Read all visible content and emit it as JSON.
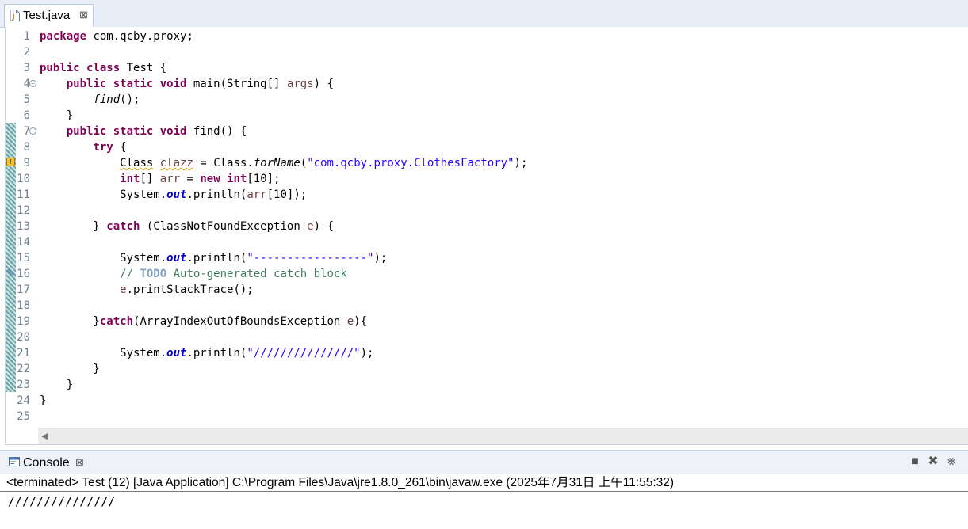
{
  "editor": {
    "tab_label": "Test.java",
    "tab_close_glyph": "⊠",
    "lines": [
      {
        "n": "1",
        "tokens": [
          {
            "c": "kw",
            "t": "package"
          },
          {
            "c": "",
            "t": " com.qcby.proxy;"
          }
        ]
      },
      {
        "n": "2",
        "tokens": []
      },
      {
        "n": "3",
        "tokens": [
          {
            "c": "kw",
            "t": "public"
          },
          {
            "c": "",
            "t": " "
          },
          {
            "c": "kw",
            "t": "class"
          },
          {
            "c": "",
            "t": " Test {"
          }
        ]
      },
      {
        "n": "4",
        "fold": true,
        "tokens": [
          {
            "c": "",
            "t": "    "
          },
          {
            "c": "kw",
            "t": "public"
          },
          {
            "c": "",
            "t": " "
          },
          {
            "c": "kw",
            "t": "static"
          },
          {
            "c": "",
            "t": " "
          },
          {
            "c": "kw",
            "t": "void"
          },
          {
            "c": "",
            "t": " main(String[] "
          },
          {
            "c": "var",
            "t": "args"
          },
          {
            "c": "",
            "t": ") {"
          }
        ]
      },
      {
        "n": "5",
        "tokens": [
          {
            "c": "",
            "t": "        "
          },
          {
            "c": "it",
            "t": "find"
          },
          {
            "c": "",
            "t": "();"
          }
        ]
      },
      {
        "n": "6",
        "tokens": [
          {
            "c": "",
            "t": "    }"
          }
        ]
      },
      {
        "n": "7",
        "fold": true,
        "tokens": [
          {
            "c": "",
            "t": "    "
          },
          {
            "c": "kw",
            "t": "public"
          },
          {
            "c": "",
            "t": " "
          },
          {
            "c": "kw",
            "t": "static"
          },
          {
            "c": "",
            "t": " "
          },
          {
            "c": "kw",
            "t": "void"
          },
          {
            "c": "",
            "t": " find() {"
          }
        ]
      },
      {
        "n": "8",
        "tokens": [
          {
            "c": "",
            "t": "        "
          },
          {
            "c": "kw",
            "t": "try"
          },
          {
            "c": "",
            "t": " {"
          }
        ]
      },
      {
        "n": "9",
        "tokens": [
          {
            "c": "",
            "t": "            "
          },
          {
            "c": "squig",
            "t": "Class"
          },
          {
            "c": "",
            "t": " "
          },
          {
            "c": "var squig",
            "t": "clazz"
          },
          {
            "c": "",
            "t": " = Class."
          },
          {
            "c": "it",
            "t": "forName"
          },
          {
            "c": "",
            "t": "("
          },
          {
            "c": "str",
            "t": "\"com.qcby.proxy.ClothesFactory\""
          },
          {
            "c": "",
            "t": ");"
          }
        ]
      },
      {
        "n": "10",
        "tokens": [
          {
            "c": "",
            "t": "            "
          },
          {
            "c": "kw",
            "t": "int"
          },
          {
            "c": "",
            "t": "[] "
          },
          {
            "c": "var",
            "t": "arr"
          },
          {
            "c": "",
            "t": " = "
          },
          {
            "c": "kw",
            "t": "new"
          },
          {
            "c": "",
            "t": " "
          },
          {
            "c": "kw",
            "t": "int"
          },
          {
            "c": "",
            "t": "[10];"
          }
        ]
      },
      {
        "n": "11",
        "tokens": [
          {
            "c": "",
            "t": "            System."
          },
          {
            "c": "stat",
            "t": "out"
          },
          {
            "c": "",
            "t": ".println("
          },
          {
            "c": "var",
            "t": "arr"
          },
          {
            "c": "",
            "t": "[10]);"
          }
        ]
      },
      {
        "n": "12",
        "tokens": []
      },
      {
        "n": "13",
        "tokens": [
          {
            "c": "",
            "t": "        } "
          },
          {
            "c": "kw",
            "t": "catch"
          },
          {
            "c": "",
            "t": " (ClassNotFoundException "
          },
          {
            "c": "var",
            "t": "e"
          },
          {
            "c": "",
            "t": ") {"
          }
        ]
      },
      {
        "n": "14",
        "tokens": []
      },
      {
        "n": "15",
        "tokens": [
          {
            "c": "",
            "t": "            System."
          },
          {
            "c": "stat",
            "t": "out"
          },
          {
            "c": "",
            "t": ".println("
          },
          {
            "c": "str",
            "t": "\"-----------------\""
          },
          {
            "c": "",
            "t": ");"
          }
        ]
      },
      {
        "n": "16",
        "tokens": [
          {
            "c": "",
            "t": "            "
          },
          {
            "c": "cm",
            "t": "// "
          },
          {
            "c": "todo",
            "t": "TODO"
          },
          {
            "c": "cm",
            "t": " Auto-generated catch block"
          }
        ]
      },
      {
        "n": "17",
        "tokens": [
          {
            "c": "",
            "t": "            "
          },
          {
            "c": "var",
            "t": "e"
          },
          {
            "c": "",
            "t": ".printStackTrace();"
          }
        ]
      },
      {
        "n": "18",
        "tokens": []
      },
      {
        "n": "19",
        "tokens": [
          {
            "c": "",
            "t": "        }"
          },
          {
            "c": "kw",
            "t": "catch"
          },
          {
            "c": "",
            "t": "(ArrayIndexOutOfBoundsException "
          },
          {
            "c": "var",
            "t": "e"
          },
          {
            "c": "",
            "t": "){"
          }
        ]
      },
      {
        "n": "20",
        "tokens": []
      },
      {
        "n": "21",
        "tokens": [
          {
            "c": "",
            "t": "            System."
          },
          {
            "c": "stat",
            "t": "out"
          },
          {
            "c": "",
            "t": ".println("
          },
          {
            "c": "str",
            "t": "\"///////////////\""
          },
          {
            "c": "",
            "t": ");"
          }
        ]
      },
      {
        "n": "22",
        "tokens": [
          {
            "c": "",
            "t": "        }"
          }
        ]
      },
      {
        "n": "23",
        "tokens": [
          {
            "c": "",
            "t": "    }"
          }
        ]
      },
      {
        "n": "24",
        "tokens": [
          {
            "c": "",
            "t": "}"
          }
        ]
      },
      {
        "n": "25",
        "tokens": []
      }
    ]
  },
  "console": {
    "tab_label": "Console",
    "tab_close_glyph": "⊠",
    "toolbar": [
      "■",
      "✖",
      "⨳"
    ],
    "status": "<terminated> Test (12) [Java Application] C:\\Program Files\\Java\\jre1.8.0_261\\bin\\javaw.exe (2025年7月31日 上午11:55:32)",
    "output": "///////////////"
  },
  "colors": {
    "keyword": "#7f0055",
    "string": "#2a00ff",
    "local_variable": "#6a3e3e",
    "static_field": "#0000c0",
    "comment": "#3f7f5f",
    "todo": "#7f9fbf"
  },
  "icons": {
    "tab_file": "java-file-icon",
    "console": "console-icon",
    "warning": "warning-icon",
    "task": "todo-task-icon"
  }
}
